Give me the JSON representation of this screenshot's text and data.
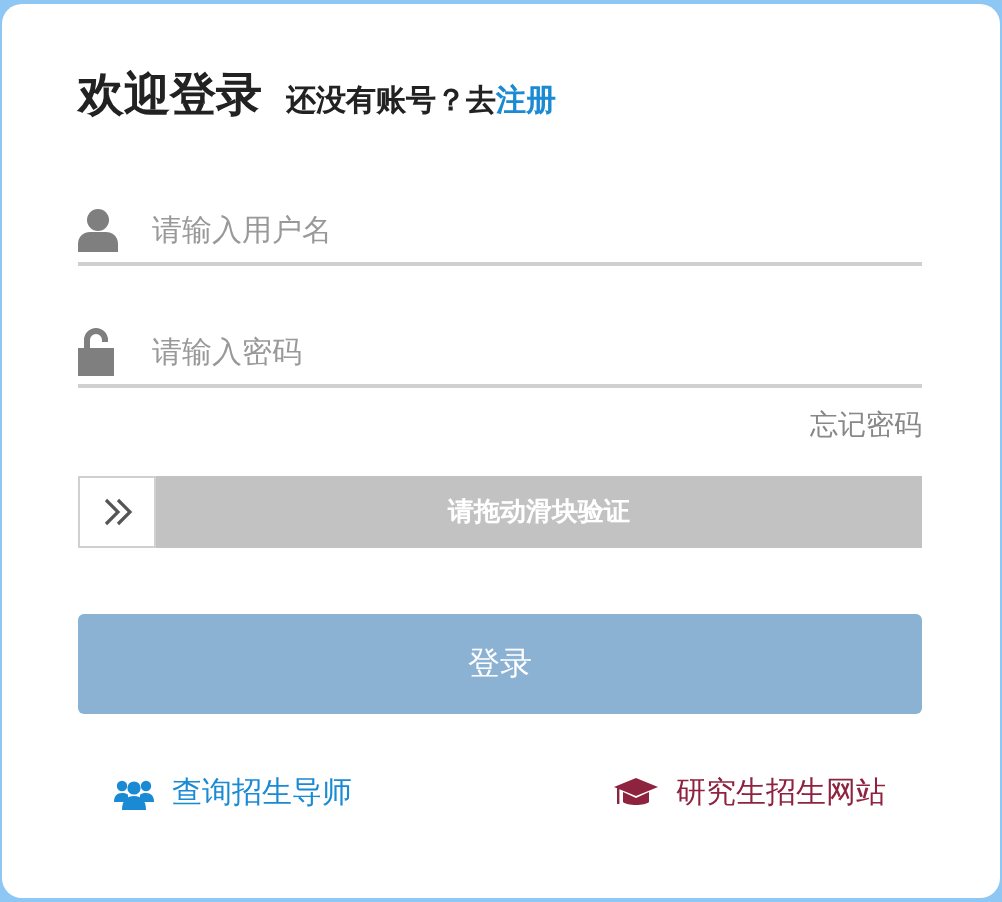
{
  "heading": {
    "title": "欢迎登录",
    "prompt": "还没有账号？去",
    "register_link": "注册"
  },
  "fields": [
    {
      "kind": "user",
      "placeholder": "请输入用户名"
    },
    {
      "kind": "password",
      "placeholder": "请输入密码"
    }
  ],
  "forgot_link": "忘记密码",
  "slider": {
    "label": "请拖动滑块验证"
  },
  "login_button": "登录",
  "links": [
    {
      "kind": "tutor",
      "label": "查询招生导师",
      "color": "#1a8ad4"
    },
    {
      "kind": "site",
      "label": "研究生招生网站",
      "color": "#8e2340"
    }
  ]
}
